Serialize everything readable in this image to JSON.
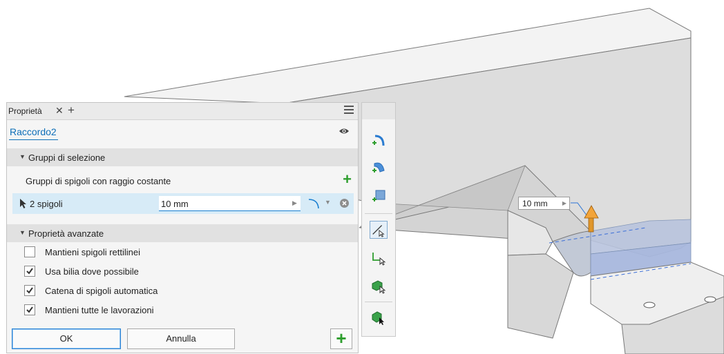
{
  "panel": {
    "tab_label": "Proprietà",
    "tab_close": "✕",
    "tab_add": "+",
    "feature_name": "Raccordo2",
    "sections": {
      "selection": "Gruppi di selezione",
      "advanced": "Proprietà avanzate"
    },
    "group_label": "Gruppi di spigoli con raggio costante",
    "selection_row": {
      "label": "2 spigoli",
      "value": "10 mm"
    },
    "options": [
      {
        "label": "Mantieni spigoli rettilinei",
        "checked": false
      },
      {
        "label": "Usa bilia dove possibile",
        "checked": true
      },
      {
        "label": "Catena di spigoli automatica",
        "checked": true
      },
      {
        "label": "Mantieni tutte le lavorazioni",
        "checked": true
      }
    ],
    "buttons": {
      "ok": "OK",
      "cancel": "Annulla",
      "add": "+"
    }
  },
  "viewport": {
    "value_box": "10 mm"
  },
  "colors": {
    "accent": "#0d6fb8",
    "add_green": "#2e9e2e",
    "selection_row": "#d7ebf7"
  }
}
